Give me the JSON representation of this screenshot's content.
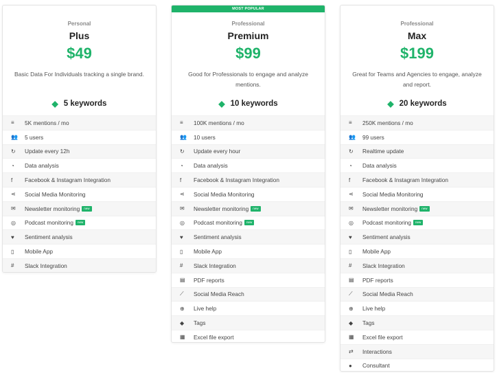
{
  "plans": [
    {
      "tier": "Personal",
      "name": "Plus",
      "price": "$49",
      "description": "Basic Data For Individuals tracking a single brand.",
      "keywords": "5 keywords",
      "features": [
        {
          "icon": "list-icon",
          "glyph": "≡",
          "label": "5K mentions / mo",
          "badge": ""
        },
        {
          "icon": "users-icon",
          "glyph": "👥",
          "label": "5 users",
          "badge": ""
        },
        {
          "icon": "refresh-icon",
          "glyph": "↻",
          "label": "Update every 12h",
          "badge": ""
        },
        {
          "icon": "pie-chart-icon",
          "glyph": "◔",
          "label": "Data analysis",
          "badge": ""
        },
        {
          "icon": "facebook-icon",
          "glyph": "f",
          "label": "Facebook & Instagram Integration",
          "badge": ""
        },
        {
          "icon": "share-icon",
          "glyph": "⋖",
          "label": "Social Media Monitoring",
          "badge": ""
        },
        {
          "icon": "envelope-icon",
          "glyph": "✉",
          "label": "Newsletter monitoring",
          "badge": "new"
        },
        {
          "icon": "podcast-icon",
          "glyph": "◎",
          "label": "Podcast monitoring",
          "badge": "new"
        },
        {
          "icon": "heart-icon",
          "glyph": "♥",
          "label": "Sentiment analysis",
          "badge": ""
        },
        {
          "icon": "mobile-icon",
          "glyph": "▯",
          "label": "Mobile App",
          "badge": ""
        },
        {
          "icon": "slack-icon",
          "glyph": "#",
          "label": "Slack Integration",
          "badge": ""
        }
      ]
    },
    {
      "ribbon": "MOST POPULAR",
      "tier": "Professional",
      "name": "Premium",
      "price": "$99",
      "description": "Good for Professionals to engage and analyze mentions.",
      "keywords": "10 keywords",
      "features": [
        {
          "icon": "list-icon",
          "glyph": "≡",
          "label": "100K mentions / mo",
          "badge": ""
        },
        {
          "icon": "users-icon",
          "glyph": "👥",
          "label": "10 users",
          "badge": ""
        },
        {
          "icon": "refresh-icon",
          "glyph": "↻",
          "label": "Update every hour",
          "badge": ""
        },
        {
          "icon": "pie-chart-icon",
          "glyph": "◔",
          "label": "Data analysis",
          "badge": ""
        },
        {
          "icon": "facebook-icon",
          "glyph": "f",
          "label": "Facebook & Instagram Integration",
          "badge": ""
        },
        {
          "icon": "share-icon",
          "glyph": "⋖",
          "label": "Social Media Monitoring",
          "badge": ""
        },
        {
          "icon": "envelope-icon",
          "glyph": "✉",
          "label": "Newsletter monitoring",
          "badge": "new"
        },
        {
          "icon": "podcast-icon",
          "glyph": "◎",
          "label": "Podcast monitoring",
          "badge": "new"
        },
        {
          "icon": "heart-icon",
          "glyph": "♥",
          "label": "Sentiment analysis",
          "badge": ""
        },
        {
          "icon": "mobile-icon",
          "glyph": "▯",
          "label": "Mobile App",
          "badge": ""
        },
        {
          "icon": "slack-icon",
          "glyph": "#",
          "label": "Slack Integration",
          "badge": ""
        },
        {
          "icon": "pdf-icon",
          "glyph": "▤",
          "label": "PDF reports",
          "badge": ""
        },
        {
          "icon": "line-chart-icon",
          "glyph": "⟋",
          "label": "Social Media Reach",
          "badge": ""
        },
        {
          "icon": "lifebuoy-icon",
          "glyph": "⊕",
          "label": "Live help",
          "badge": ""
        },
        {
          "icon": "tags-icon",
          "glyph": "◆",
          "label": "Tags",
          "badge": ""
        },
        {
          "icon": "excel-icon",
          "glyph": "▦",
          "label": "Excel file export",
          "badge": ""
        }
      ]
    },
    {
      "tier": "Professional",
      "name": "Max",
      "price": "$199",
      "description": "Great for Teams and Agencies to engage, analyze and report.",
      "keywords": "20 keywords",
      "features": [
        {
          "icon": "list-icon",
          "glyph": "≡",
          "label": "250K mentions / mo",
          "badge": ""
        },
        {
          "icon": "users-icon",
          "glyph": "👥",
          "label": "99 users",
          "badge": ""
        },
        {
          "icon": "refresh-icon",
          "glyph": "↻",
          "label": "Realtime update",
          "badge": ""
        },
        {
          "icon": "pie-chart-icon",
          "glyph": "◔",
          "label": "Data analysis",
          "badge": ""
        },
        {
          "icon": "facebook-icon",
          "glyph": "f",
          "label": "Facebook & Instagram Integration",
          "badge": ""
        },
        {
          "icon": "share-icon",
          "glyph": "⋖",
          "label": "Social Media Monitoring",
          "badge": ""
        },
        {
          "icon": "envelope-icon",
          "glyph": "✉",
          "label": "Newsletter monitoring",
          "badge": "new"
        },
        {
          "icon": "podcast-icon",
          "glyph": "◎",
          "label": "Podcast monitoring",
          "badge": "new"
        },
        {
          "icon": "heart-icon",
          "glyph": "♥",
          "label": "Sentiment analysis",
          "badge": ""
        },
        {
          "icon": "mobile-icon",
          "glyph": "▯",
          "label": "Mobile App",
          "badge": ""
        },
        {
          "icon": "slack-icon",
          "glyph": "#",
          "label": "Slack Integration",
          "badge": ""
        },
        {
          "icon": "pdf-icon",
          "glyph": "▤",
          "label": "PDF reports",
          "badge": ""
        },
        {
          "icon": "line-chart-icon",
          "glyph": "⟋",
          "label": "Social Media Reach",
          "badge": ""
        },
        {
          "icon": "lifebuoy-icon",
          "glyph": "⊕",
          "label": "Live help",
          "badge": ""
        },
        {
          "icon": "tags-icon",
          "glyph": "◆",
          "label": "Tags",
          "badge": ""
        },
        {
          "icon": "excel-icon",
          "glyph": "▦",
          "label": "Excel file export",
          "badge": ""
        },
        {
          "icon": "retweet-icon",
          "glyph": "⇄",
          "label": "Interactions",
          "badge": ""
        },
        {
          "icon": "user-icon",
          "glyph": "●",
          "label": "Consultant",
          "badge": ""
        }
      ]
    }
  ],
  "colors": {
    "accent": "#1fb36a"
  }
}
